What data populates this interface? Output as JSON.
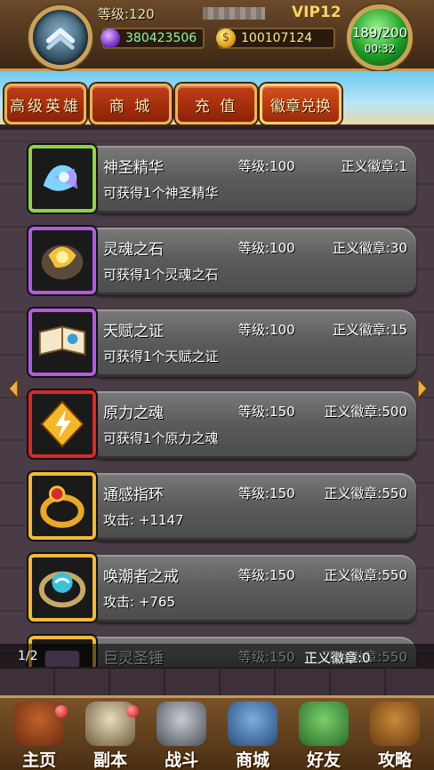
{
  "hud": {
    "level_label": "等级:120",
    "vip": "VIP12",
    "gems": "380423506",
    "gold": "100107124",
    "stamina": "189/200",
    "stamina_timer": "00:32"
  },
  "tabs": [
    {
      "label": "高级英雄"
    },
    {
      "label": "商 城"
    },
    {
      "label": "充 值"
    },
    {
      "label": "徽章兑换"
    }
  ],
  "items": [
    {
      "name": "神圣精华",
      "level": "等级:100",
      "cost": "正义徽章:1",
      "desc": "可获得1个神圣精华",
      "frame_color": "#8fd14a",
      "icon": "essence-icon"
    },
    {
      "name": "灵魂之石",
      "level": "等级:100",
      "cost": "正义徽章:30",
      "desc": "可获得1个灵魂之石",
      "frame_color": "#b15be0",
      "icon": "soulstone-icon"
    },
    {
      "name": "天赋之证",
      "level": "等级:100",
      "cost": "正义徽章:15",
      "desc": "可获得1个天赋之证",
      "frame_color": "#b15be0",
      "icon": "talent-book-icon"
    },
    {
      "name": "原力之魂",
      "level": "等级:150",
      "cost": "正义徽章:500",
      "desc": "可获得1个原力之魂",
      "frame_color": "#d62a2a",
      "icon": "force-soul-icon"
    },
    {
      "name": "通感指环",
      "level": "等级:150",
      "cost": "正义徽章:550",
      "desc": "攻击: +1147",
      "frame_color": "#f0b93a",
      "icon": "ring-icon"
    },
    {
      "name": "唤潮者之戒",
      "level": "等级:150",
      "cost": "正义徽章:550",
      "desc": "攻击: +765",
      "frame_color": "#f0b93a",
      "icon": "tide-ring-icon"
    },
    {
      "name": "巨灵圣锤",
      "level": "等级:150",
      "cost": "正义徽章:550",
      "desc": "",
      "frame_color": "#f0b93a",
      "icon": "hammer-icon"
    }
  ],
  "footer": {
    "page": "1/2",
    "my_badges": "正义徽章:0"
  },
  "nav": [
    {
      "label": "主页"
    },
    {
      "label": "副本"
    },
    {
      "label": "战斗"
    },
    {
      "label": "商城"
    },
    {
      "label": "好友"
    },
    {
      "label": "攻略"
    }
  ]
}
